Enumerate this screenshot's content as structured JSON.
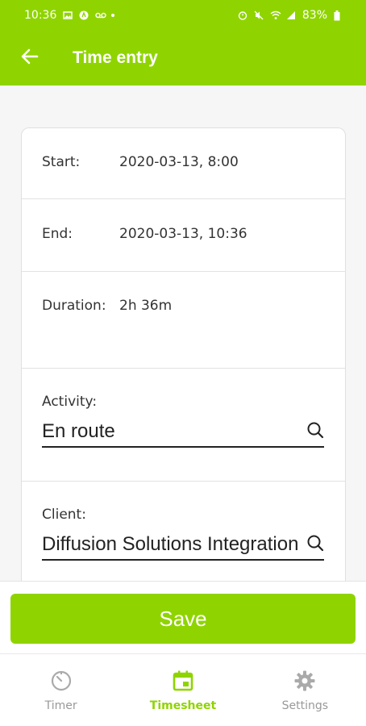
{
  "status_bar": {
    "time": "10:36",
    "battery": "83%"
  },
  "app_bar": {
    "title": "Time entry",
    "back_icon": "arrow-left-icon"
  },
  "form": {
    "start": {
      "label": "Start:",
      "value": "2020-03-13, 8:00"
    },
    "end": {
      "label": "End:",
      "value": "2020-03-13, 10:36"
    },
    "duration": {
      "label": "Duration:",
      "value": "2h 36m"
    },
    "activity": {
      "label": "Activity:",
      "value": "En route",
      "icon": "search-icon"
    },
    "client": {
      "label": "Client:",
      "value": "Diffusion Solutions Integration",
      "icon": "search-icon"
    }
  },
  "actions": {
    "save_label": "Save"
  },
  "bottom_nav": {
    "items": [
      {
        "label": "Timer",
        "icon": "timer-icon",
        "active": false
      },
      {
        "label": "Timesheet",
        "icon": "calendar-icon",
        "active": true
      },
      {
        "label": "Settings",
        "icon": "gear-icon",
        "active": false
      }
    ]
  },
  "colors": {
    "accent": "#8fd400",
    "inactive": "#999999",
    "text": "#333333"
  }
}
